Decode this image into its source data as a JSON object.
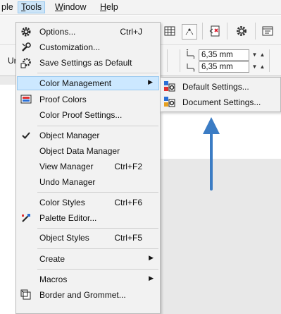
{
  "menubar": {
    "items": [
      {
        "label": "ple"
      },
      {
        "label": "Tools",
        "active": true
      },
      {
        "label": "Window"
      },
      {
        "label": "Help"
      }
    ]
  },
  "toolbar": {
    "left_text": "Ur",
    "nudge_x": "6,35 mm",
    "nudge_y": "6,35 mm"
  },
  "tools_menu": {
    "items": [
      {
        "label": "Options...",
        "shortcut": "Ctrl+J",
        "icon": "gear-icon"
      },
      {
        "label": "Customization...",
        "icon": "wrench-icon"
      },
      {
        "label": "Save Settings as Default",
        "icon": "gear-save-icon"
      },
      {
        "label": "Color Management",
        "submenu": true
      },
      {
        "label": "Proof Colors",
        "icon": "proof-colors-icon"
      },
      {
        "label": "Color Proof Settings..."
      },
      {
        "label": "Object Manager",
        "checked": true
      },
      {
        "label": "Object Data Manager"
      },
      {
        "label": "View Manager",
        "shortcut": "Ctrl+F2"
      },
      {
        "label": "Undo Manager"
      },
      {
        "label": "Color Styles",
        "shortcut": "Ctrl+F6"
      },
      {
        "label": "Palette Editor...",
        "icon": "palette-editor-icon"
      },
      {
        "label": "Object Styles",
        "shortcut": "Ctrl+F5"
      },
      {
        "label": "Create",
        "submenu": true
      },
      {
        "label": "Macros",
        "submenu": true
      },
      {
        "label": "Border and Grommet...",
        "icon": "border-grommet-icon"
      }
    ]
  },
  "color_submenu": {
    "items": [
      {
        "label": "Default Settings...",
        "icon": "color-settings-icon"
      },
      {
        "label": "Document Settings...",
        "icon": "document-color-settings-icon"
      }
    ]
  },
  "colors": {
    "highlight": "#cce8ff",
    "highlight_border": "#99c9ef",
    "annotation_arrow": "#3b7cc4"
  }
}
